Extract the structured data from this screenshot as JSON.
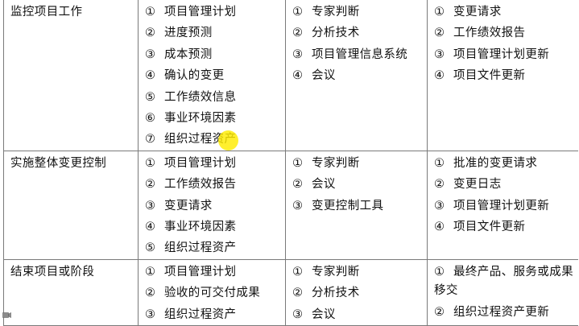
{
  "colors": {
    "border": "#7a7a7a",
    "text": "#111111",
    "highlight": "#ffeb00"
  },
  "icons": {
    "cursor_highlight": "yellow-cursor-highlight",
    "recorder": "camera-icon"
  },
  "rows": [
    {
      "process": "监控项目工作",
      "inputs": [
        {
          "num": "①",
          "text": "项目管理计划"
        },
        {
          "num": "②",
          "text": "进度预测"
        },
        {
          "num": "③",
          "text": "成本预测"
        },
        {
          "num": "④",
          "text": "确认的变更"
        },
        {
          "num": "⑤",
          "text": "工作绩效信息"
        },
        {
          "num": "⑥",
          "text": "事业环境因素"
        },
        {
          "num": "⑦",
          "text": "组织过程资产"
        }
      ],
      "tools": [
        {
          "num": "①",
          "text": "专家判断"
        },
        {
          "num": "②",
          "text": "分析技术"
        },
        {
          "num": "③",
          "text": "项目管理信息系统"
        },
        {
          "num": "④",
          "text": "会议"
        }
      ],
      "outputs": [
        {
          "num": "①",
          "text": "变更请求"
        },
        {
          "num": "②",
          "text": "工作绩效报告"
        },
        {
          "num": "③",
          "text": "项目管理计划更新"
        },
        {
          "num": "④",
          "text": "项目文件更新"
        }
      ]
    },
    {
      "process": "实施整体变更控制",
      "inputs": [
        {
          "num": "①",
          "text": "项目管理计划"
        },
        {
          "num": "②",
          "text": "工作绩效报告"
        },
        {
          "num": "③",
          "text": "变更请求"
        },
        {
          "num": "④",
          "text": "事业环境因素"
        },
        {
          "num": "⑤",
          "text": "组织过程资产"
        }
      ],
      "tools": [
        {
          "num": "①",
          "text": "专家判断"
        },
        {
          "num": "②",
          "text": "会议"
        },
        {
          "num": "③",
          "text": "变更控制工具"
        }
      ],
      "outputs": [
        {
          "num": "①",
          "text": "批准的变更请求"
        },
        {
          "num": "②",
          "text": "变更日志"
        },
        {
          "num": "③",
          "text": "项目管理计划更新"
        },
        {
          "num": "④",
          "text": "项目文件更新"
        }
      ]
    },
    {
      "process": "结束项目或阶段",
      "inputs": [
        {
          "num": "①",
          "text": "项目管理计划"
        },
        {
          "num": "②",
          "text": "验收的可交付成果"
        },
        {
          "num": "③",
          "text": "组织过程资产"
        }
      ],
      "tools": [
        {
          "num": "①",
          "text": "专家判断"
        },
        {
          "num": "②",
          "text": "分析技术"
        },
        {
          "num": "③",
          "text": "会议"
        }
      ],
      "outputs": [
        {
          "num": "①",
          "text": "最终产品、服务或成果移交"
        },
        {
          "num": "②",
          "text": "组织过程资产更新"
        }
      ]
    }
  ]
}
